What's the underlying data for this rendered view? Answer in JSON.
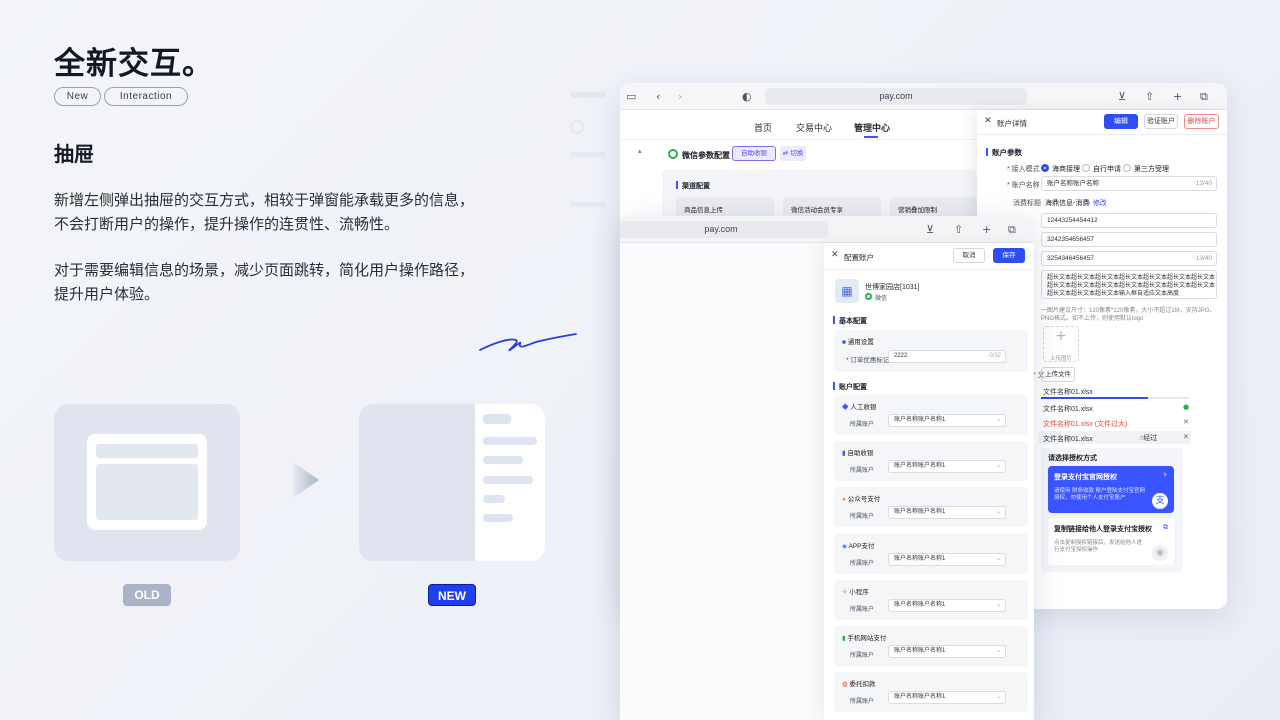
{
  "headline": "全新交互。",
  "tags": [
    "New",
    "Interaction"
  ],
  "section_title": "抽屉",
  "paragraphs": [
    [
      "新增左侧弹出抽屉的交互方式，相较于弹窗能承载更多的信息，",
      "不会打断用户的操作，提升操作的连贯性、流畅性。"
    ],
    [
      "对于需要编辑信息的场景，减少页面跳转，简化用户操作路径，",
      "提升用户体验。"
    ]
  ],
  "badges": {
    "old": "OLD",
    "new": "NEW"
  },
  "colors": {
    "accent": "#2040f0",
    "old_badge": "#a9b4c8"
  },
  "back": {
    "url": "pay.com",
    "nav": [
      "首页",
      "交易中心",
      "管理中心"
    ],
    "side_label": "微信参数配置",
    "tab_active": "自助收银",
    "tab_switch": "切换",
    "channel_section": "渠道配置",
    "channel_cards": [
      "商品信息上传",
      "微信活动会员专享",
      "营销叠加限制"
    ],
    "drawer": {
      "title": "账户详情",
      "btn_edit": "编辑",
      "btn_verify": "验证账户",
      "btn_delete": "删除账户",
      "section": "账户参数",
      "access_mode_label": "接入模式",
      "access_modes": [
        "海商接理",
        "自行申请",
        "第三方受理"
      ],
      "account_name_label": "账户名称",
      "account_name_value": "账户名称账户名称",
      "account_name_count": "13/40",
      "consume_label": "消费标题",
      "consume_value": "海鼎信息-消费",
      "consume_edit": "修改",
      "field1": "12443254454412",
      "field2": "3242354656457",
      "field3": "3254346456457",
      "field3_count": "13/40",
      "longtext": "超长文本超长文本超长文本超长文本超长文本超长文本超长文本超长文本超长文本超长文本超长文本超长文本超长文本超长文本超长文本超长文本超长文本输入框自适应文本高度",
      "img_hint": "一图片建议尺寸：120像素*120像素，大小不超过1M，支持JPG、PNG格式。如不上传，则使用默认logo",
      "upload_img": "上传图片",
      "upload_file": "上传文件",
      "file_label": "文",
      "files": [
        {
          "name": "文件名称01.xlsx",
          "state": "uploading"
        },
        {
          "name": "文件名称01.xlsx",
          "state": "done"
        },
        {
          "name": "文件名称01.xlsx (文件过大)",
          "state": "error"
        },
        {
          "name": "文件名称01.xlsx",
          "state": "hover"
        }
      ],
      "hover_text": "经过",
      "auth_title": "请选择授权方式",
      "auth1_title": "登录支付宝官网授权",
      "auth1_desc": "请使用 财务收款 账户登陆支付宝官网授权，勿使用个人支付宝账户",
      "auth2_title": "复制链接给他人登录支付宝授权",
      "auth2_desc": "点击复制授权链接后，发送给他人进行支付宝授权操作"
    }
  },
  "front": {
    "url": "pay.com",
    "drawer_title": "配置账户",
    "btn_cancel": "取消",
    "btn_save": "保存",
    "store_name": "世博家园店[1031]",
    "store_channel": "微信",
    "basic_section": "基本配置",
    "general": "通用设置",
    "discount_label": "订单优惠标记",
    "discount_value": "2222",
    "discount_count": "0/32",
    "account_section": "账户配置",
    "account_field_label": "所属账户",
    "account_value": "账户名称账户名称1",
    "blocks": [
      "人工收银",
      "自助收银",
      "公众号支付",
      "APP支付",
      "小程序",
      "手机网站支付",
      "委托扣款"
    ]
  }
}
